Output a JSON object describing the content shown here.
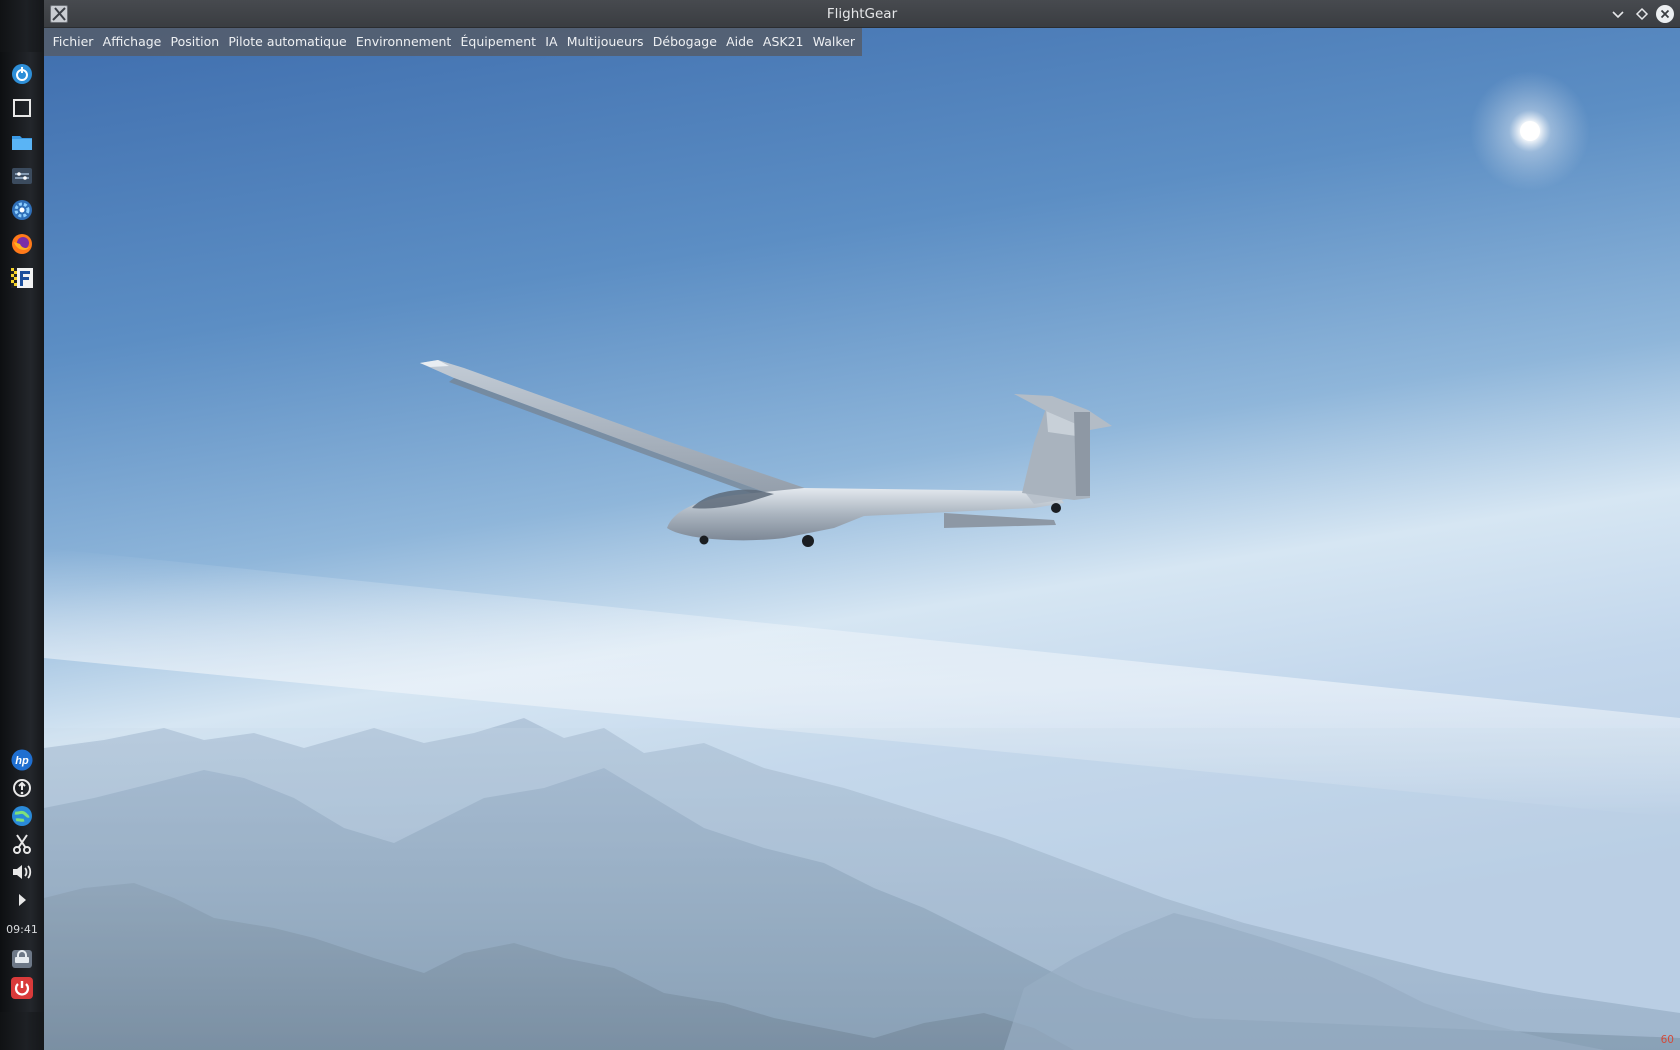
{
  "window": {
    "title": "FlightGear"
  },
  "menubar": {
    "items": [
      {
        "label": "Fichier"
      },
      {
        "label": "Affichage"
      },
      {
        "label": "Position"
      },
      {
        "label": "Pilote automatique"
      },
      {
        "label": "Environnement"
      },
      {
        "label": "Équipement"
      },
      {
        "label": "IA"
      },
      {
        "label": "Multijoueurs"
      },
      {
        "label": "Débogage"
      },
      {
        "label": "Aide"
      },
      {
        "label": "ASK21"
      },
      {
        "label": "Walker"
      }
    ]
  },
  "taskbar": {
    "launchers": [
      {
        "icon": "app-launcher-icon"
      },
      {
        "icon": "show-desktop-icon"
      },
      {
        "icon": "file-manager-icon"
      },
      {
        "icon": "system-settings-icon"
      },
      {
        "icon": "software-center-icon"
      },
      {
        "icon": "firefox-icon"
      },
      {
        "icon": "flightgear-icon"
      }
    ],
    "tray": [
      {
        "icon": "hp-icon"
      },
      {
        "icon": "updates-icon"
      },
      {
        "icon": "network-icon"
      },
      {
        "icon": "screenshot-icon"
      },
      {
        "icon": "volume-icon"
      },
      {
        "icon": "expand-tray-icon"
      }
    ],
    "clock": "09:41",
    "bottom": [
      {
        "icon": "lock-screen-icon"
      },
      {
        "icon": "power-icon"
      }
    ]
  },
  "hud": {
    "fps": "60"
  },
  "colors": {
    "sky_top": "#3f6fae",
    "sky_horizon": "#d9e6f2",
    "mountains": "#8ea6c0",
    "power": "#d93a3a"
  }
}
